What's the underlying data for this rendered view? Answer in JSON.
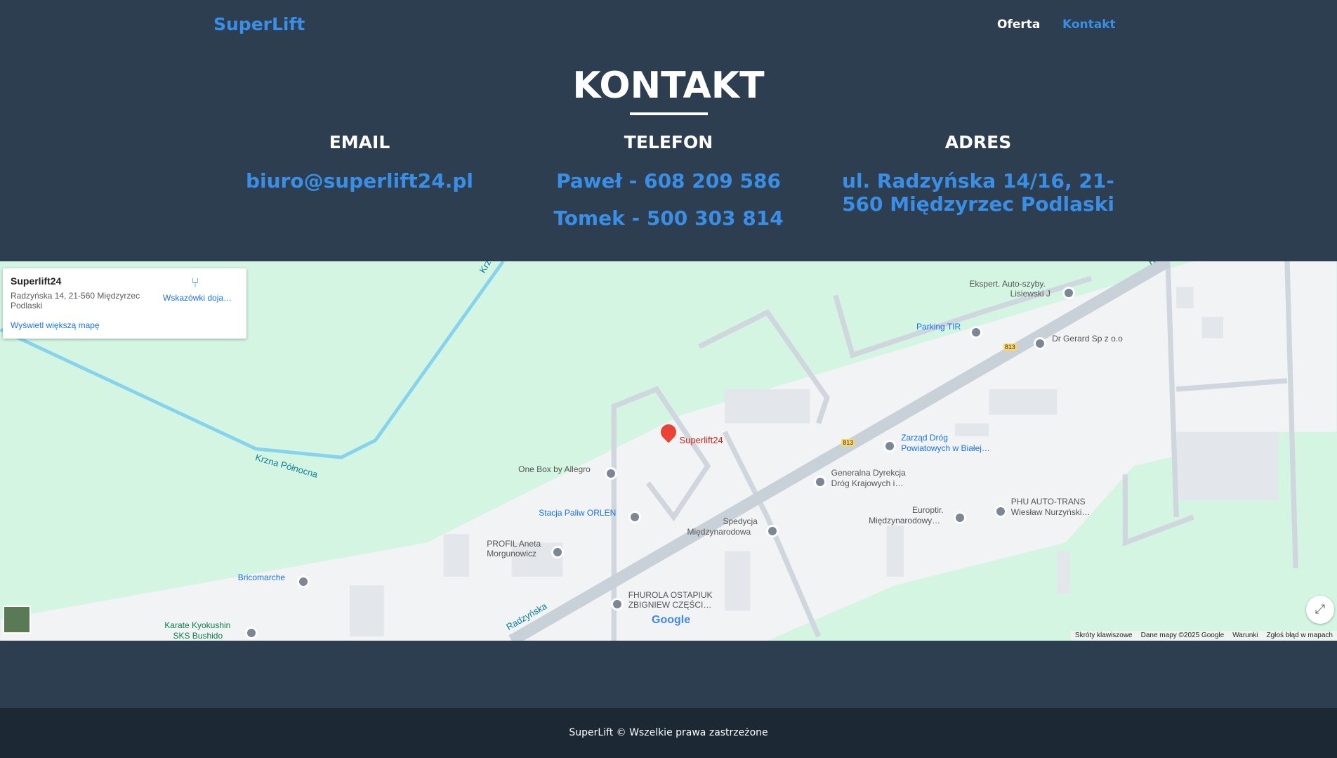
{
  "nav": {
    "logo": "SuperLift",
    "links": [
      {
        "label": "Oferta",
        "color": "#ffffff"
      },
      {
        "label": "Kontakt",
        "color": "#3a8ee6"
      }
    ]
  },
  "contact": {
    "title": "KONTAKT",
    "email": {
      "heading": "EMAIL",
      "value": "biuro@superlift24.pl"
    },
    "phone": {
      "heading": "TELEFON",
      "values": [
        "Paweł - 608 209 586",
        "Tomek - 500 303 814"
      ]
    },
    "address": {
      "heading": "ADRES",
      "value": "ul. Radzyńska 14/16, 21-560 Międzyrzec Podlaski"
    }
  },
  "map": {
    "card": {
      "name": "Superlift24",
      "address": "Radzyńska 14, 21-560 Międzyrzec Podlaski",
      "directions": "Wskazówki doja…",
      "larger_map": "Wyświetl większą mapę",
      "directions_icon": "directions-icon"
    },
    "marker_label": "Superlift24",
    "pois": [
      "Ekspert. Auto-szyby.",
      "Lisiewski J",
      "Parking TIR",
      "Dr Gerard Sp z o.o",
      "Zarząd Dróg",
      "Powiatowych w Białej…",
      "Generalna Dyrekcja",
      "Dróg Krajowych i…",
      "One Box by Allegro",
      "Stacja Paliw ORLEN",
      "PHU AUTO-TRANS",
      "Wiesław Nurzyński…",
      "Europtir.",
      "Międzynarodowy…",
      "Spedycja",
      "Międzynarodowa",
      "PROFIL Aneta",
      "Morgunowicz",
      "Bricomarche",
      "FHUROLA OSTAPIUK",
      "ZBIGNIEW CZĘŚCI…",
      "Karate Kyokushin",
      "SKS Bushido"
    ],
    "roads": [
      "Krzna Północna",
      "Krzna",
      "813",
      "813",
      "Radzyńska",
      "Ra…"
    ],
    "google": "Google",
    "attribution": [
      "Skróty klawiszowe",
      "Dane mapy ©2025 Google",
      "Warunki",
      "Zgłoś błąd w mapach"
    ]
  },
  "footer": "SuperLift © Wszelkie prawa zastrzeżone"
}
